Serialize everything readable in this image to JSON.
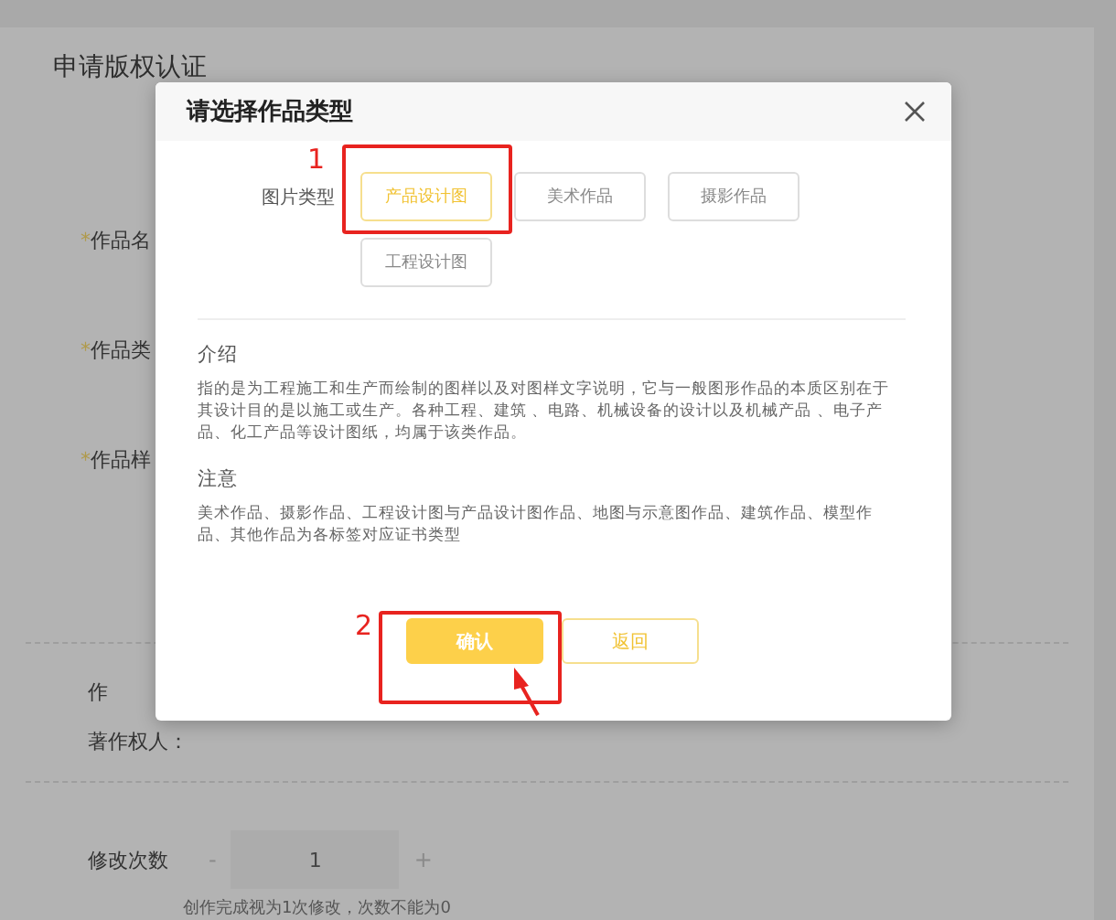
{
  "page": {
    "title": "申请版权认证",
    "form_labels": [
      {
        "mark": "*",
        "text": "作品名"
      },
      {
        "mark": "*",
        "text": "作品类"
      },
      {
        "mark": "*",
        "text": "作品样"
      }
    ],
    "author_row": [
      "作",
      "著作权人："
    ],
    "revisions": {
      "label": "修改次数",
      "decrement": "-",
      "value": "1",
      "increment": "+",
      "hint": "创作完成视为1次修改，次数不能为0"
    }
  },
  "dialog": {
    "title": "请选择作品类型",
    "type_label": "图片类型",
    "types": [
      {
        "label": "产品设计图",
        "selected": true
      },
      {
        "label": "美术作品",
        "selected": false
      },
      {
        "label": "摄影作品",
        "selected": false
      },
      {
        "label": "工程设计图",
        "selected": false
      }
    ],
    "sections": [
      {
        "heading": "介绍",
        "text": "指的是为工程施工和生产而绘制的图样以及对图样文字说明，它与一般图形作品的本质区别在于其设计目的是以施工或生产。各种工程、建筑 、电路、机械设备的设计以及机械产品 、电子产品、化工产品等设计图纸，均属于该类作品。"
      },
      {
        "heading": "注意",
        "text": "美术作品、摄影作品、工程设计图与产品设计图作品、地图与示意图作品、建筑作品、模型作品、其他作品为各标签对应证书类型"
      }
    ],
    "buttons": [
      {
        "label": "确认",
        "kind": "primary"
      },
      {
        "label": "返回",
        "kind": "secondary"
      }
    ]
  },
  "annotations": [
    {
      "number": "1",
      "arrow": false
    },
    {
      "number": "2",
      "arrow": true
    }
  ]
}
